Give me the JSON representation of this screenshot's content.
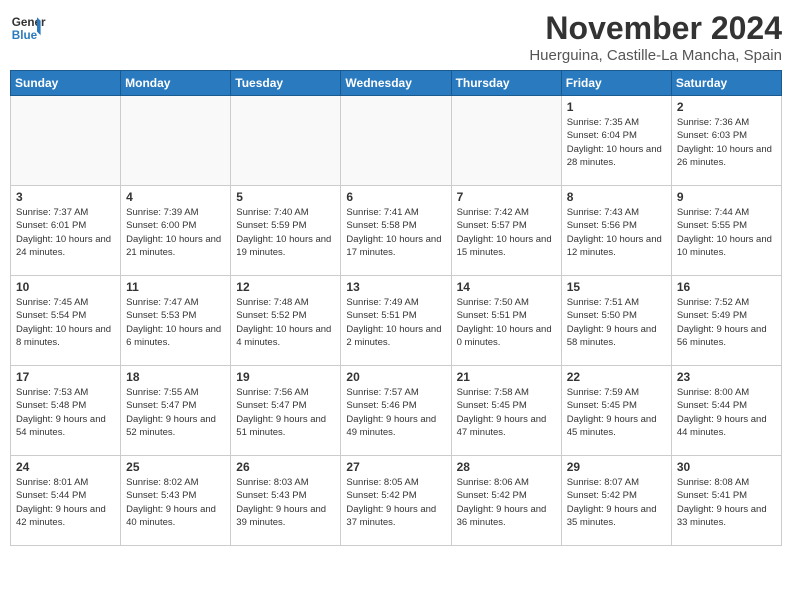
{
  "logo": {
    "line1": "General",
    "line2": "Blue"
  },
  "title": "November 2024",
  "location": "Huerguina, Castille-La Mancha, Spain",
  "days_of_week": [
    "Sunday",
    "Monday",
    "Tuesday",
    "Wednesday",
    "Thursday",
    "Friday",
    "Saturday"
  ],
  "weeks": [
    [
      {
        "day": "",
        "sunrise": "",
        "sunset": "",
        "daylight": ""
      },
      {
        "day": "",
        "sunrise": "",
        "sunset": "",
        "daylight": ""
      },
      {
        "day": "",
        "sunrise": "",
        "sunset": "",
        "daylight": ""
      },
      {
        "day": "",
        "sunrise": "",
        "sunset": "",
        "daylight": ""
      },
      {
        "day": "",
        "sunrise": "",
        "sunset": "",
        "daylight": ""
      },
      {
        "day": "1",
        "sunrise": "Sunrise: 7:35 AM",
        "sunset": "Sunset: 6:04 PM",
        "daylight": "Daylight: 10 hours and 28 minutes."
      },
      {
        "day": "2",
        "sunrise": "Sunrise: 7:36 AM",
        "sunset": "Sunset: 6:03 PM",
        "daylight": "Daylight: 10 hours and 26 minutes."
      }
    ],
    [
      {
        "day": "3",
        "sunrise": "Sunrise: 7:37 AM",
        "sunset": "Sunset: 6:01 PM",
        "daylight": "Daylight: 10 hours and 24 minutes."
      },
      {
        "day": "4",
        "sunrise": "Sunrise: 7:39 AM",
        "sunset": "Sunset: 6:00 PM",
        "daylight": "Daylight: 10 hours and 21 minutes."
      },
      {
        "day": "5",
        "sunrise": "Sunrise: 7:40 AM",
        "sunset": "Sunset: 5:59 PM",
        "daylight": "Daylight: 10 hours and 19 minutes."
      },
      {
        "day": "6",
        "sunrise": "Sunrise: 7:41 AM",
        "sunset": "Sunset: 5:58 PM",
        "daylight": "Daylight: 10 hours and 17 minutes."
      },
      {
        "day": "7",
        "sunrise": "Sunrise: 7:42 AM",
        "sunset": "Sunset: 5:57 PM",
        "daylight": "Daylight: 10 hours and 15 minutes."
      },
      {
        "day": "8",
        "sunrise": "Sunrise: 7:43 AM",
        "sunset": "Sunset: 5:56 PM",
        "daylight": "Daylight: 10 hours and 12 minutes."
      },
      {
        "day": "9",
        "sunrise": "Sunrise: 7:44 AM",
        "sunset": "Sunset: 5:55 PM",
        "daylight": "Daylight: 10 hours and 10 minutes."
      }
    ],
    [
      {
        "day": "10",
        "sunrise": "Sunrise: 7:45 AM",
        "sunset": "Sunset: 5:54 PM",
        "daylight": "Daylight: 10 hours and 8 minutes."
      },
      {
        "day": "11",
        "sunrise": "Sunrise: 7:47 AM",
        "sunset": "Sunset: 5:53 PM",
        "daylight": "Daylight: 10 hours and 6 minutes."
      },
      {
        "day": "12",
        "sunrise": "Sunrise: 7:48 AM",
        "sunset": "Sunset: 5:52 PM",
        "daylight": "Daylight: 10 hours and 4 minutes."
      },
      {
        "day": "13",
        "sunrise": "Sunrise: 7:49 AM",
        "sunset": "Sunset: 5:51 PM",
        "daylight": "Daylight: 10 hours and 2 minutes."
      },
      {
        "day": "14",
        "sunrise": "Sunrise: 7:50 AM",
        "sunset": "Sunset: 5:51 PM",
        "daylight": "Daylight: 10 hours and 0 minutes."
      },
      {
        "day": "15",
        "sunrise": "Sunrise: 7:51 AM",
        "sunset": "Sunset: 5:50 PM",
        "daylight": "Daylight: 9 hours and 58 minutes."
      },
      {
        "day": "16",
        "sunrise": "Sunrise: 7:52 AM",
        "sunset": "Sunset: 5:49 PM",
        "daylight": "Daylight: 9 hours and 56 minutes."
      }
    ],
    [
      {
        "day": "17",
        "sunrise": "Sunrise: 7:53 AM",
        "sunset": "Sunset: 5:48 PM",
        "daylight": "Daylight: 9 hours and 54 minutes."
      },
      {
        "day": "18",
        "sunrise": "Sunrise: 7:55 AM",
        "sunset": "Sunset: 5:47 PM",
        "daylight": "Daylight: 9 hours and 52 minutes."
      },
      {
        "day": "19",
        "sunrise": "Sunrise: 7:56 AM",
        "sunset": "Sunset: 5:47 PM",
        "daylight": "Daylight: 9 hours and 51 minutes."
      },
      {
        "day": "20",
        "sunrise": "Sunrise: 7:57 AM",
        "sunset": "Sunset: 5:46 PM",
        "daylight": "Daylight: 9 hours and 49 minutes."
      },
      {
        "day": "21",
        "sunrise": "Sunrise: 7:58 AM",
        "sunset": "Sunset: 5:45 PM",
        "daylight": "Daylight: 9 hours and 47 minutes."
      },
      {
        "day": "22",
        "sunrise": "Sunrise: 7:59 AM",
        "sunset": "Sunset: 5:45 PM",
        "daylight": "Daylight: 9 hours and 45 minutes."
      },
      {
        "day": "23",
        "sunrise": "Sunrise: 8:00 AM",
        "sunset": "Sunset: 5:44 PM",
        "daylight": "Daylight: 9 hours and 44 minutes."
      }
    ],
    [
      {
        "day": "24",
        "sunrise": "Sunrise: 8:01 AM",
        "sunset": "Sunset: 5:44 PM",
        "daylight": "Daylight: 9 hours and 42 minutes."
      },
      {
        "day": "25",
        "sunrise": "Sunrise: 8:02 AM",
        "sunset": "Sunset: 5:43 PM",
        "daylight": "Daylight: 9 hours and 40 minutes."
      },
      {
        "day": "26",
        "sunrise": "Sunrise: 8:03 AM",
        "sunset": "Sunset: 5:43 PM",
        "daylight": "Daylight: 9 hours and 39 minutes."
      },
      {
        "day": "27",
        "sunrise": "Sunrise: 8:05 AM",
        "sunset": "Sunset: 5:42 PM",
        "daylight": "Daylight: 9 hours and 37 minutes."
      },
      {
        "day": "28",
        "sunrise": "Sunrise: 8:06 AM",
        "sunset": "Sunset: 5:42 PM",
        "daylight": "Daylight: 9 hours and 36 minutes."
      },
      {
        "day": "29",
        "sunrise": "Sunrise: 8:07 AM",
        "sunset": "Sunset: 5:42 PM",
        "daylight": "Daylight: 9 hours and 35 minutes."
      },
      {
        "day": "30",
        "sunrise": "Sunrise: 8:08 AM",
        "sunset": "Sunset: 5:41 PM",
        "daylight": "Daylight: 9 hours and 33 minutes."
      }
    ]
  ]
}
